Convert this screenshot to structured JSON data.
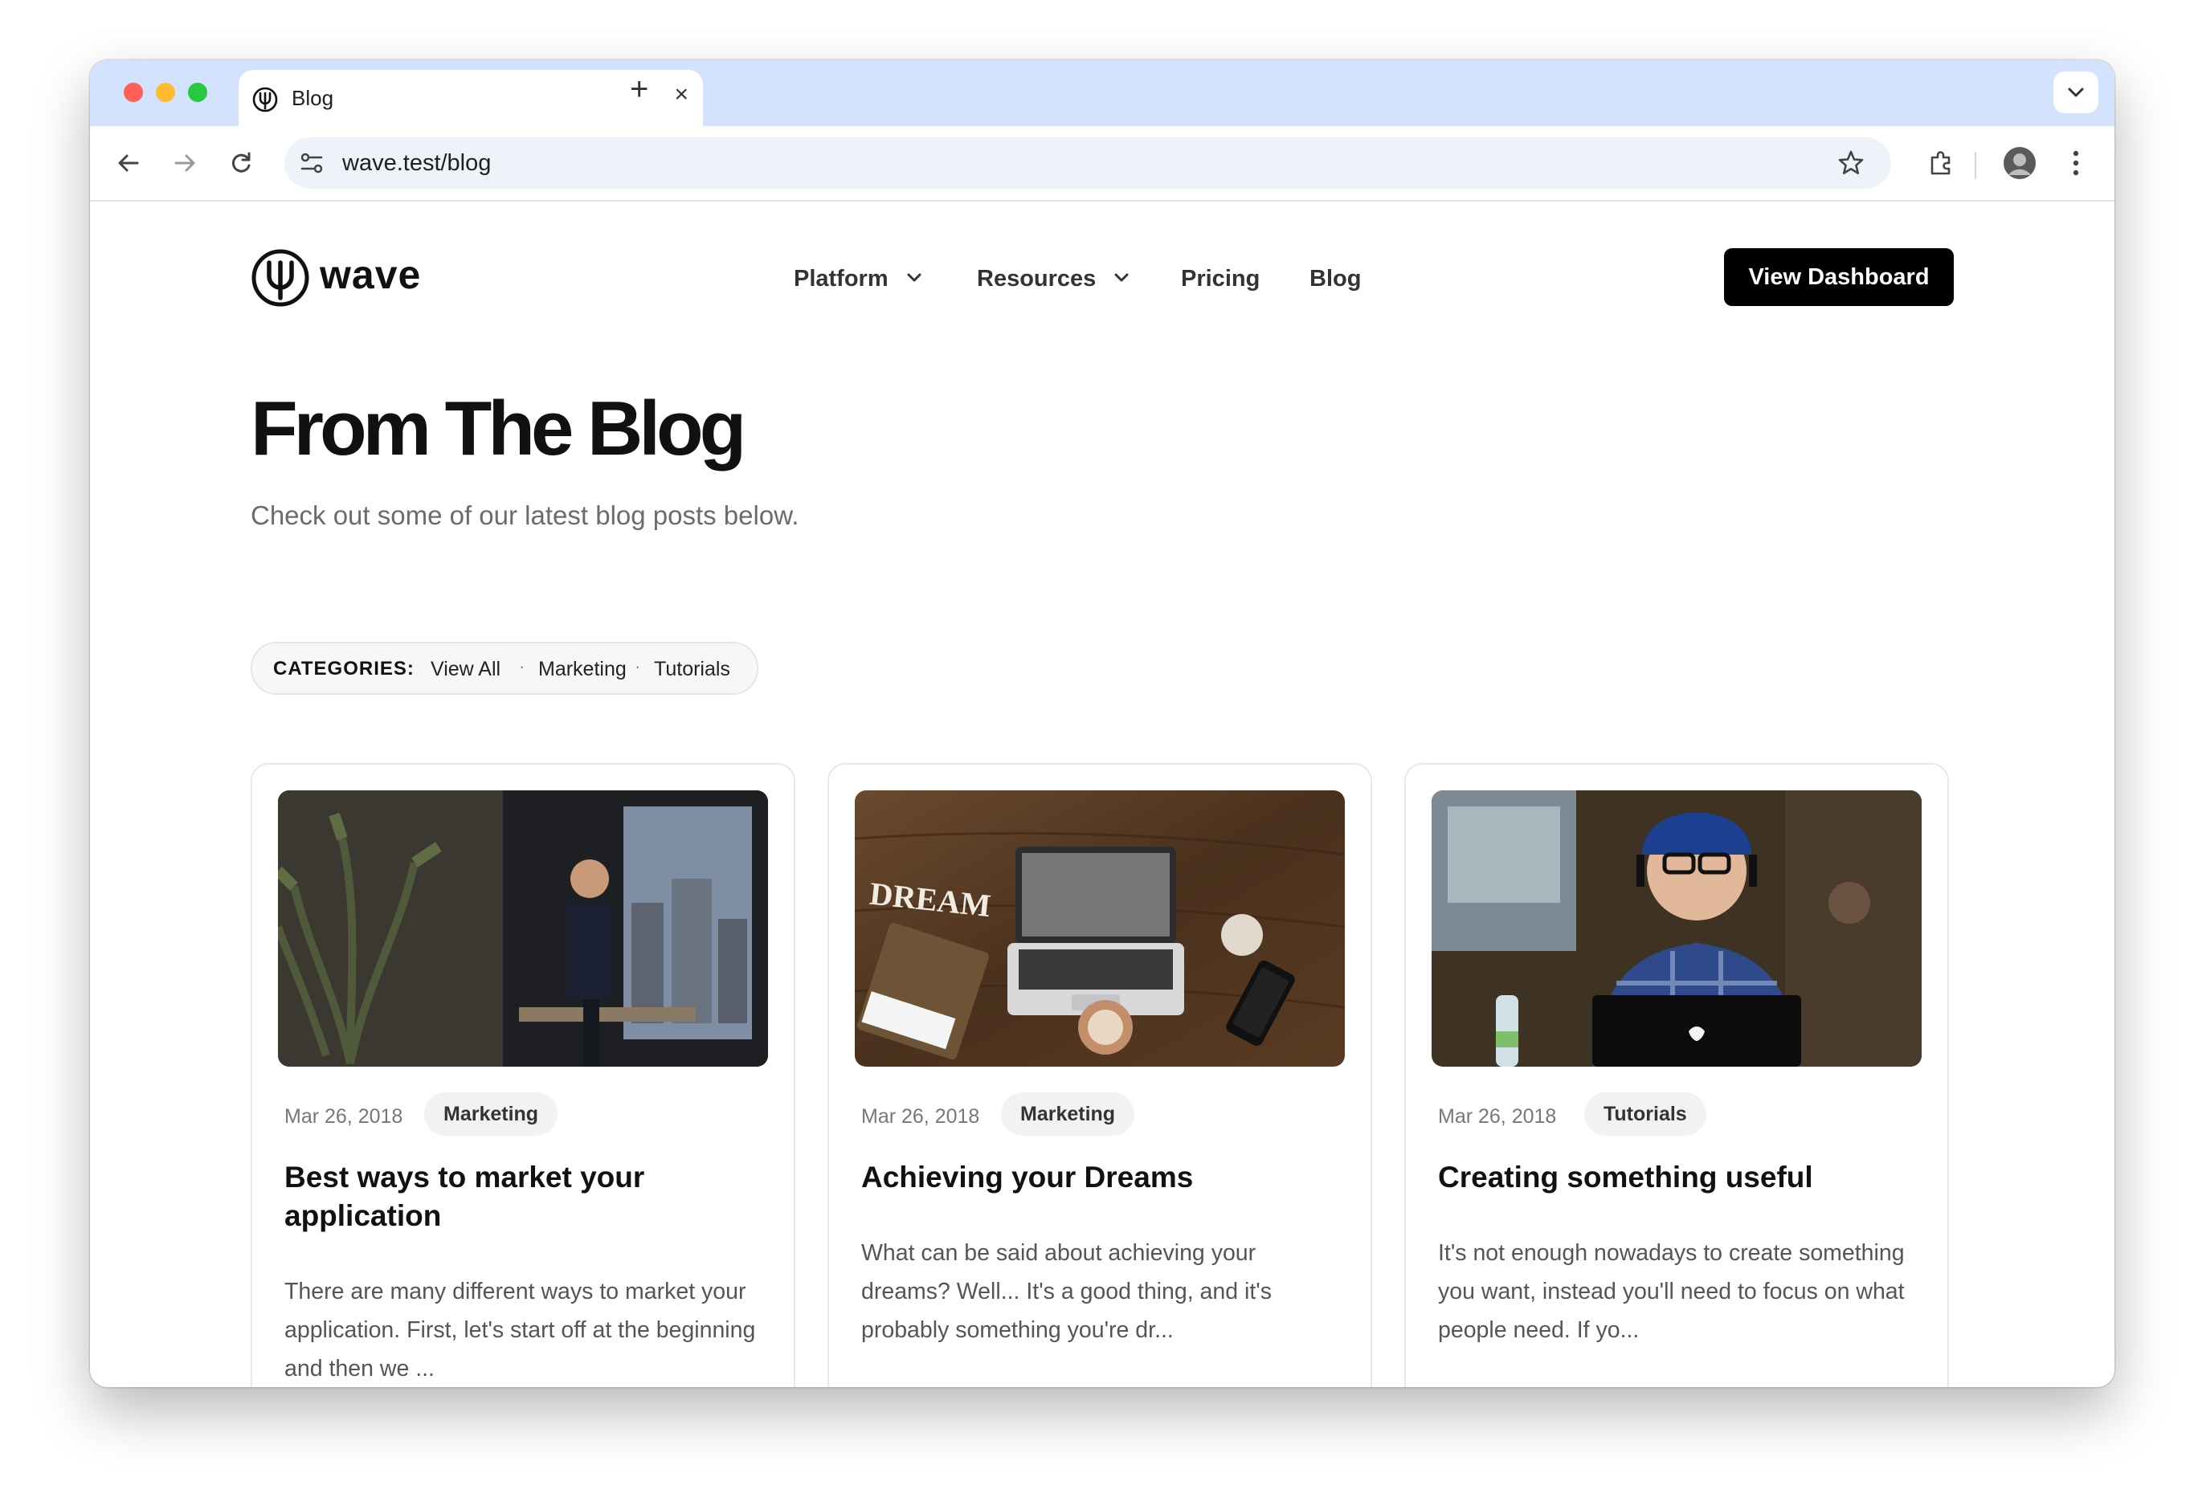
{
  "browser": {
    "tab_title": "Blog",
    "tab_close": "×",
    "new_tab": "+",
    "url": "wave.test/blog",
    "icons": [
      "back-icon",
      "forward-icon",
      "reload-icon",
      "site-info-icon",
      "bookmark-star-icon",
      "extensions-icon",
      "profile-avatar-icon",
      "menu-kebab-icon",
      "tab-search-icon"
    ]
  },
  "site": {
    "brand": "wave",
    "nav": {
      "platform": "Platform",
      "resources": "Resources",
      "pricing": "Pricing",
      "blog": "Blog"
    },
    "cta": "View Dashboard"
  },
  "hero": {
    "title": "From The Blog",
    "subtitle": "Check out some of our latest blog posts below."
  },
  "categories": {
    "label": "CATEGORIES:",
    "items": [
      "View All",
      "Marketing",
      "Tutorials"
    ],
    "separator": "·"
  },
  "posts": [
    {
      "date": "Mar 26, 2018",
      "category": "Marketing",
      "title": "Best ways to market your application",
      "excerpt": "There are many different ways to market your application. First, let's start off at the beginning and then we ..."
    },
    {
      "date": "Mar 26, 2018",
      "category": "Marketing",
      "title": "Achieving your Dreams",
      "excerpt": "What can be said about achieving your dreams? Well... It's a good thing, and it's probably something you're dr..."
    },
    {
      "date": "Mar 26, 2018",
      "category": "Tutorials",
      "title": "Creating something useful",
      "excerpt": "It's not enough nowadays to create something you want, instead you'll need to focus on what people need. If yo..."
    }
  ],
  "images": {
    "post1_word": "",
    "post2_word": "DREAM"
  },
  "colors": {
    "tabstrip": "#d3e3fd",
    "cta_bg": "#000000",
    "badge_bg": "#f2f2f2"
  }
}
